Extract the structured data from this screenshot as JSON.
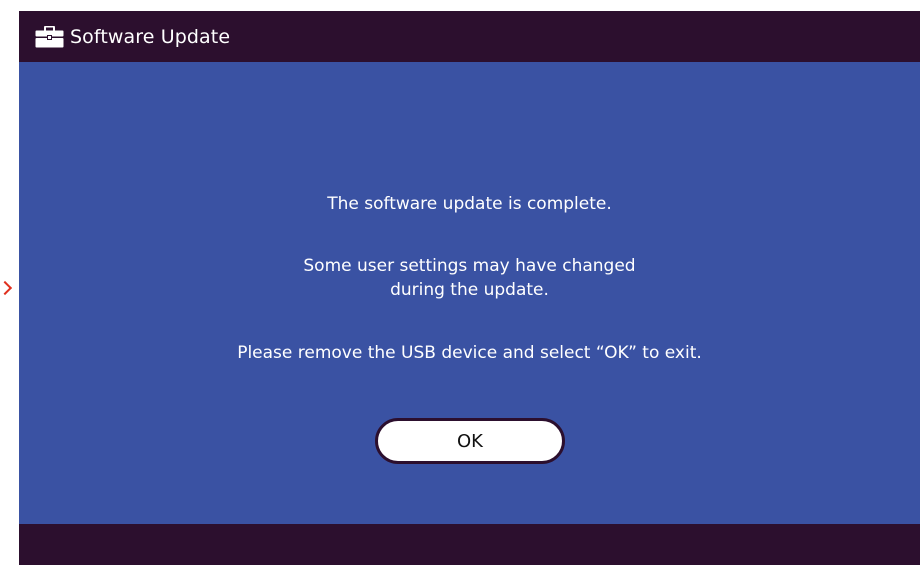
{
  "window": {
    "title": "Software Update",
    "icon": "toolbox-icon"
  },
  "dialog": {
    "message_line_1": "The software update is complete.",
    "message_line_2a": "Some user settings may have changed",
    "message_line_2b": "during the update.",
    "message_line_3": "Please remove the USB device and select “OK” to exit.",
    "ok_label": "OK"
  },
  "colors": {
    "background": "#3a52a3",
    "bars": "#2c0f2e",
    "text": "#ffffff",
    "button_fill": "#ffffff",
    "marker": "#e0301e"
  }
}
